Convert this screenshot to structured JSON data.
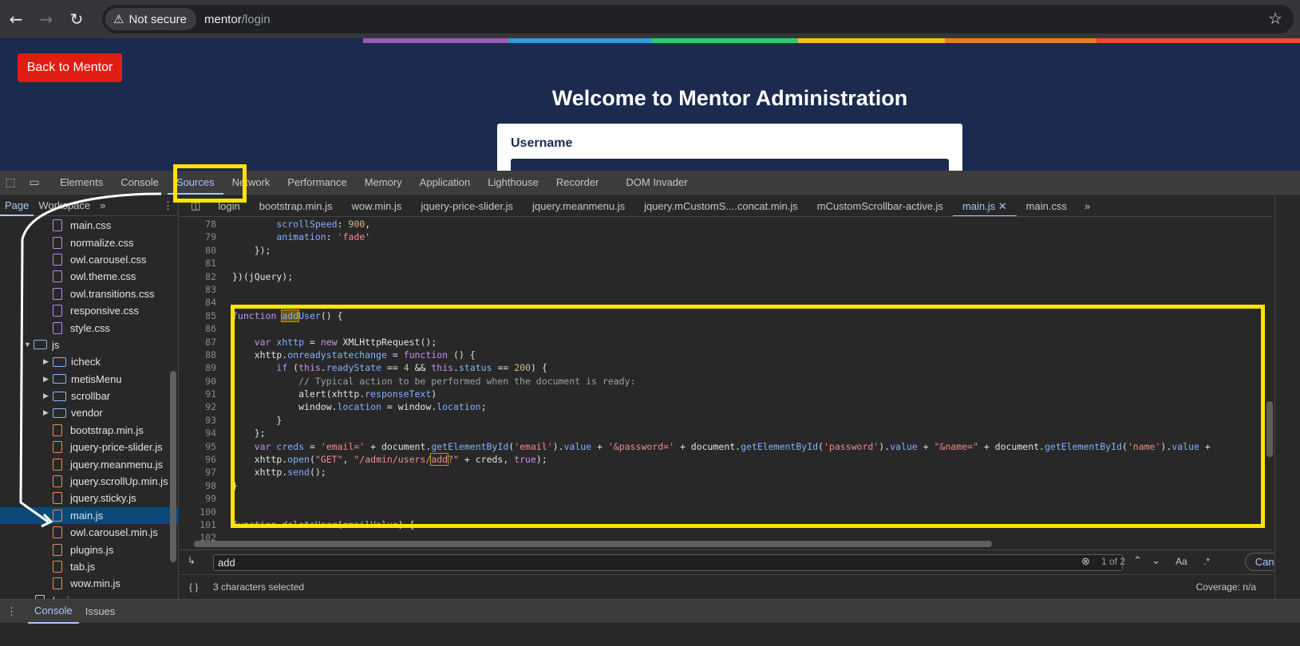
{
  "browser": {
    "security_label": "Not secure",
    "url_host": "mentor",
    "url_path": "/login",
    "rainbow": [
      "#1b2a4e",
      "#9b59b6",
      "#3498db",
      "#2ecc71",
      "#f1c40f",
      "#e67e22",
      "#e74c3c"
    ]
  },
  "page": {
    "back_button": "Back to Mentor",
    "heading": "Welcome to Mentor Administration",
    "username_label": "Username"
  },
  "devtools": {
    "tabs": [
      "Elements",
      "Console",
      "Sources",
      "Network",
      "Performance",
      "Memory",
      "Application",
      "Lighthouse",
      "Recorder",
      "DOM Invader"
    ],
    "active_tab": "Sources",
    "nav_tabs": [
      "Page",
      "Workspace"
    ],
    "files": [
      {
        "name": "main.css",
        "type": "css",
        "indent": 2
      },
      {
        "name": "normalize.css",
        "type": "css",
        "indent": 2
      },
      {
        "name": "owl.carousel.css",
        "type": "css",
        "indent": 2
      },
      {
        "name": "owl.theme.css",
        "type": "css",
        "indent": 2
      },
      {
        "name": "owl.transitions.css",
        "type": "css",
        "indent": 2
      },
      {
        "name": "responsive.css",
        "type": "css",
        "indent": 2
      },
      {
        "name": "style.css",
        "type": "css",
        "indent": 2
      },
      {
        "name": "js",
        "type": "folder-open",
        "indent": 1
      },
      {
        "name": "icheck",
        "type": "folder",
        "indent": 2
      },
      {
        "name": "metisMenu",
        "type": "folder",
        "indent": 2
      },
      {
        "name": "scrollbar",
        "type": "folder",
        "indent": 2
      },
      {
        "name": "vendor",
        "type": "folder",
        "indent": 2
      },
      {
        "name": "bootstrap.min.js",
        "type": "js",
        "indent": 2
      },
      {
        "name": "jquery-price-slider.js",
        "type": "js",
        "indent": 2
      },
      {
        "name": "jquery.meanmenu.js",
        "type": "js",
        "indent": 2
      },
      {
        "name": "jquery.scrollUp.min.js",
        "type": "js",
        "indent": 2
      },
      {
        "name": "jquery.sticky.js",
        "type": "js",
        "indent": 2
      },
      {
        "name": "main.js",
        "type": "js",
        "indent": 2,
        "selected": true
      },
      {
        "name": "owl.carousel.min.js",
        "type": "js",
        "indent": 2
      },
      {
        "name": "plugins.js",
        "type": "js",
        "indent": 2
      },
      {
        "name": "tab.js",
        "type": "js",
        "indent": 2
      },
      {
        "name": "wow.min.js",
        "type": "js",
        "indent": 2
      },
      {
        "name": "login",
        "type": "doc",
        "indent": 0
      }
    ],
    "editor_tabs": [
      "login",
      "bootstrap.min.js",
      "wow.min.js",
      "jquery-price-slider.js",
      "jquery.meanmenu.js",
      "jquery.mCustomS....concat.min.js",
      "mCustomScrollbar-active.js",
      "main.js",
      "main.css"
    ],
    "active_editor_tab": "main.js",
    "search_query": "add",
    "match_count": "1 of 2",
    "match_case_label": "Aa",
    "regex_label": ".*",
    "cancel_label": "Cancel",
    "status_text": "3 characters selected",
    "coverage_text": "Coverage: n/a",
    "drawer_tabs": [
      "Console",
      "Issues"
    ]
  }
}
